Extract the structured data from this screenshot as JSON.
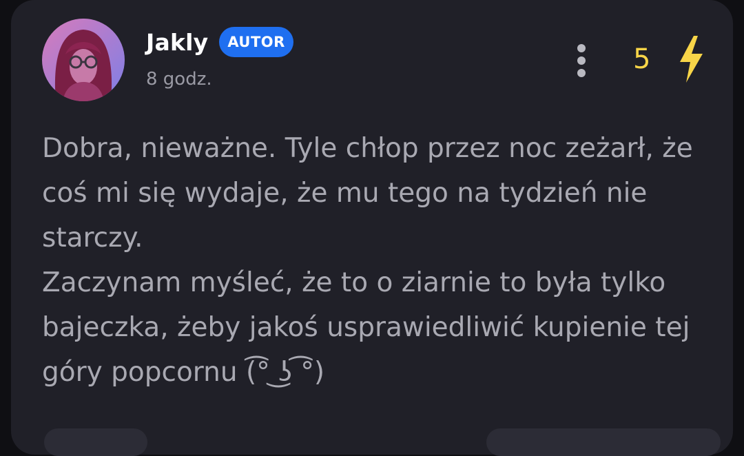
{
  "comment": {
    "author": {
      "name": "Jakly",
      "badge": "AUTOR"
    },
    "timestamp": "8 godz.",
    "score": "5",
    "body": {
      "paragraphs": [
        "Dobra, nieważne. Tyle chłop przez noc zeżarł, że coś mi się wydaje, że mu tego na tydzień nie starczy.",
        "Zaczynam myśleć, że to o ziarnie to była tylko bajeczka, żeby jakoś usprawiedliwić kupienie tej góry popcornu (͡° ͜ʖ ͡°)"
      ]
    }
  },
  "icons": {
    "menu": "more-vertical-icon",
    "score": "lightning-bolt-icon",
    "avatar": "user-avatar"
  },
  "colors": {
    "background": "#0f0f13",
    "card": "#202028",
    "badge": "#1f6ff0",
    "score": "#f8d548",
    "body_text": "#a9a9b2",
    "muted_text": "#9a9aa4"
  }
}
